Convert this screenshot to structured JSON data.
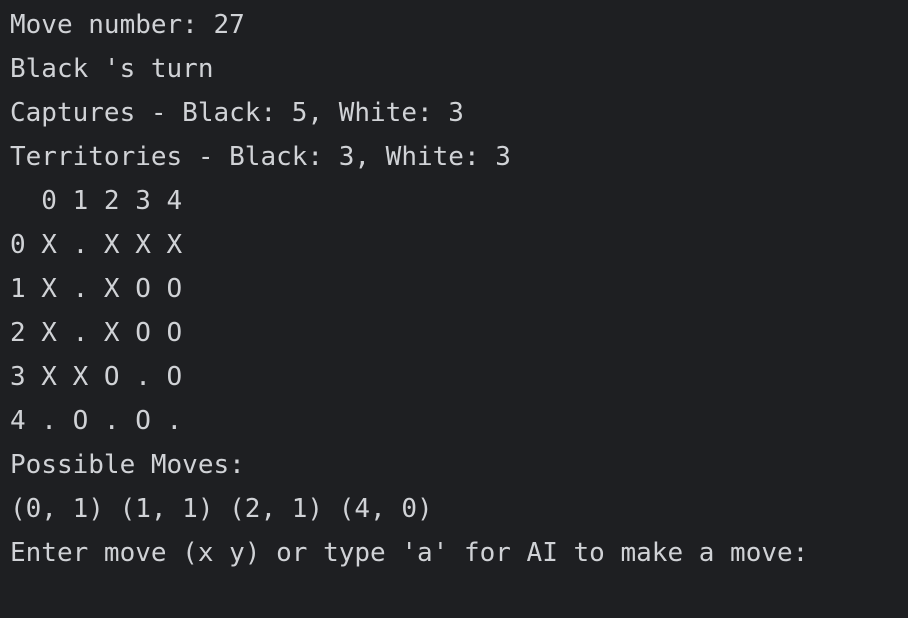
{
  "console": {
    "lines": [
      "Move number: 27",
      "Black 's turn",
      "Captures - Black: 5, White: 3",
      "Territories - Black: 3, White: 3",
      "  0 1 2 3 4",
      "0 X . X X X",
      "1 X . X O O",
      "2 X . X O O",
      "3 X X O . O",
      "4 . O . O .",
      "Possible Moves:",
      "(0, 1) (1, 1) (2, 1) (4, 0)",
      "Enter move (x y) or type 'a' for AI to make a move: "
    ]
  }
}
